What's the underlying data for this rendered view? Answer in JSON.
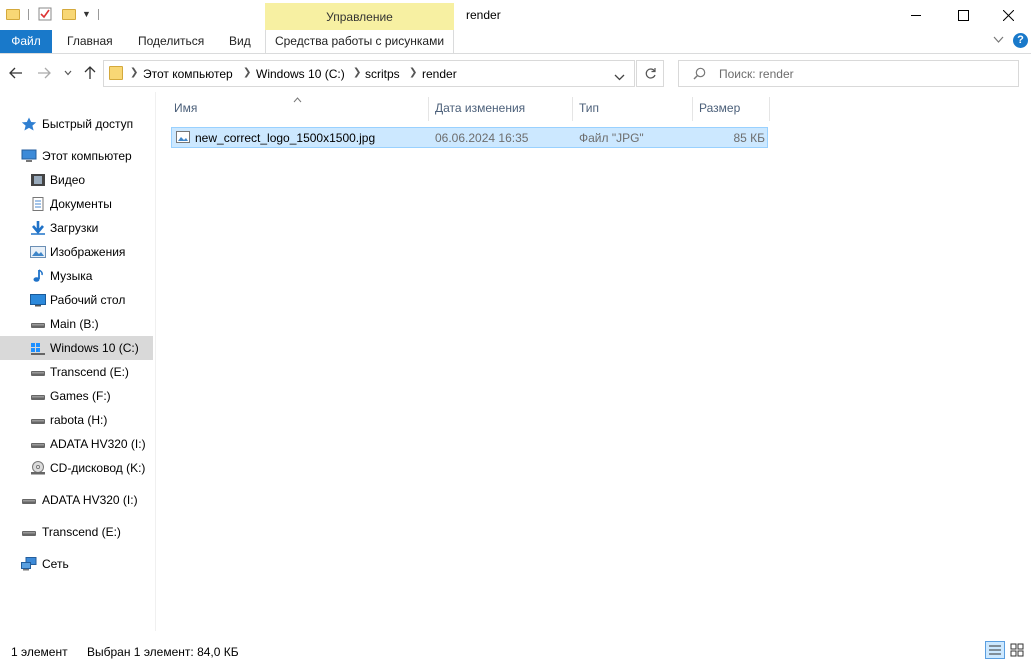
{
  "window": {
    "title": "render",
    "manage_tab": "Управление",
    "picture_tools_tab": "Средства работы с рисунками"
  },
  "ribbon": {
    "file": "Файл",
    "tabs": [
      "Главная",
      "Поделиться",
      "Вид"
    ]
  },
  "address": {
    "crumbs": [
      "Этот компьютер",
      "Windows 10 (C:)",
      "scritps",
      "render"
    ],
    "search_placeholder": "Поиск: render"
  },
  "sidebar": {
    "quick_access": "Быстрый доступ",
    "this_pc": "Этот компьютер",
    "items": [
      {
        "label": "Видео",
        "icon": "video-folder-icon"
      },
      {
        "label": "Документы",
        "icon": "documents-folder-icon"
      },
      {
        "label": "Загрузки",
        "icon": "downloads-folder-icon"
      },
      {
        "label": "Изображения",
        "icon": "pictures-folder-icon"
      },
      {
        "label": "Музыка",
        "icon": "music-folder-icon"
      },
      {
        "label": "Рабочий стол",
        "icon": "desktop-folder-icon"
      },
      {
        "label": "Main (B:)",
        "icon": "drive-icon"
      },
      {
        "label": "Windows 10 (C:)",
        "icon": "windows-drive-icon"
      },
      {
        "label": "Transcend (E:)",
        "icon": "drive-icon"
      },
      {
        "label": "Games (F:)",
        "icon": "drive-icon"
      },
      {
        "label": "rabota (H:)",
        "icon": "drive-icon"
      },
      {
        "label": "ADATA HV320 (I:)",
        "icon": "drive-icon"
      },
      {
        "label": "CD-дисковод (K:)",
        "icon": "cd-drive-icon"
      }
    ],
    "extra": [
      {
        "label": "ADATA HV320 (I:)",
        "icon": "drive-icon"
      },
      {
        "label": "Transcend (E:)",
        "icon": "drive-icon"
      },
      {
        "label": "Сеть",
        "icon": "network-icon"
      }
    ]
  },
  "columns": {
    "name": "Имя",
    "modified": "Дата изменения",
    "type": "Тип",
    "size": "Размер"
  },
  "files": [
    {
      "name": "new_correct_logo_1500x1500.jpg",
      "modified": "06.06.2024 16:35",
      "type": "Файл \"JPG\"",
      "size": "85 КБ"
    }
  ],
  "status": {
    "count": "1 элемент",
    "selected": "Выбран 1 элемент: 84,0 КБ"
  }
}
